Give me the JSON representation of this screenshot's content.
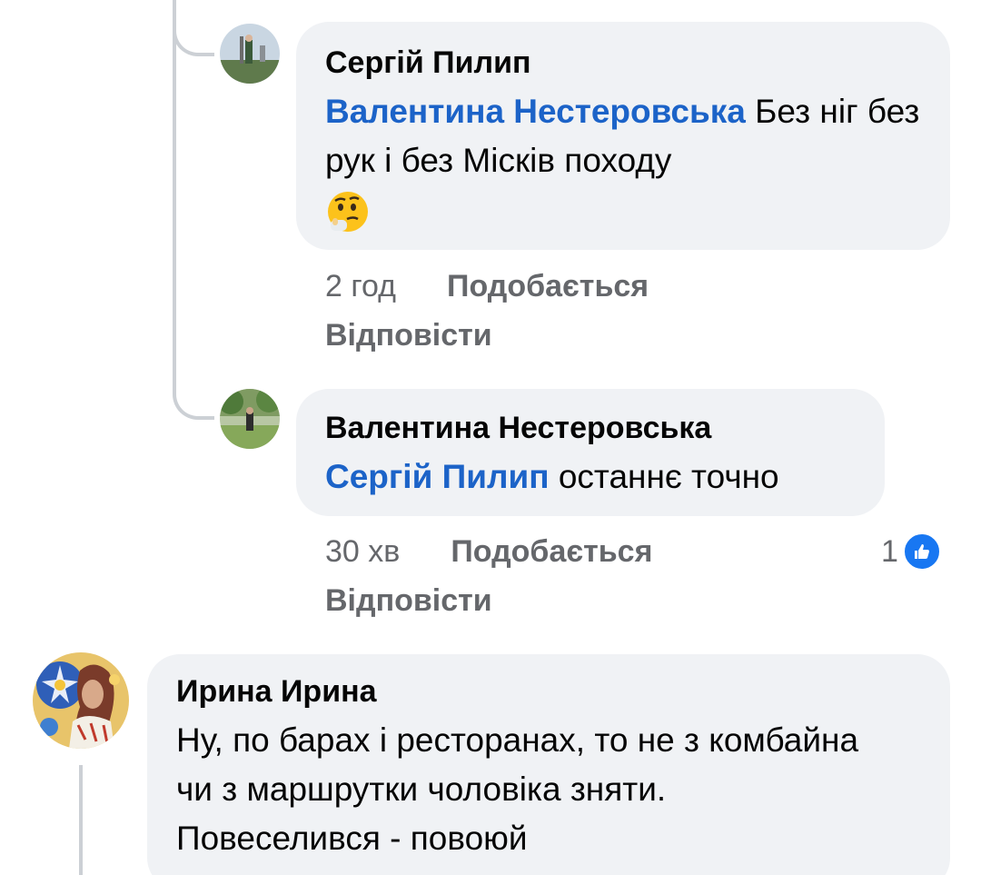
{
  "comments": [
    {
      "author": "Сергій Пилип",
      "mention": "Валентина Нестеровська",
      "text": " Без ніг без рук і без Місків походу",
      "emoji": "thinking-face-emoji",
      "time": "2 год",
      "like_label": "Подобається",
      "reply_label": "Відповісти"
    },
    {
      "author": "Валентина Нестеровська",
      "mention": "Сергій Пилип",
      "text": " останнє точно",
      "time": "30 хв",
      "like_label": "Подобається",
      "reply_label": "Відповісти",
      "reaction_count": "1",
      "reaction_icon": "like-icon"
    },
    {
      "author": "Ирина Ирина",
      "text": "Ну, по барах і ресторанах, то не з комбайна чи з маршрутки чоловіка зняти. Повеселився - повоюй"
    }
  ],
  "colors": {
    "bubble_bg": "#f0f2f5",
    "mention": "#1c63c8",
    "meta_text": "#65676b",
    "like_blue": "#1877f2",
    "thread_line": "#ccd0d5"
  }
}
